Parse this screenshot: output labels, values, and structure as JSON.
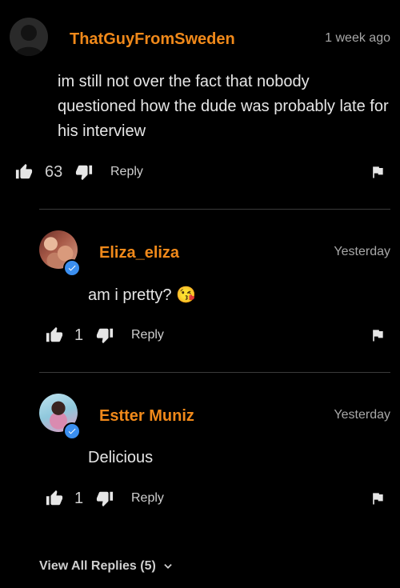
{
  "comment": {
    "username": "ThatGuyFromSweden",
    "timestamp": "1 week ago",
    "text": "im still not over the fact that nobody questioned how the dude was probably late for his interview",
    "likes": "63",
    "reply_label": "Reply"
  },
  "replies": [
    {
      "username": "Eliza_eliza",
      "timestamp": "Yesterday",
      "text": "am i pretty? 😘",
      "likes": "1",
      "reply_label": "Reply",
      "verified": true
    },
    {
      "username": "Estter Muniz",
      "timestamp": "Yesterday",
      "text": "Delicious",
      "likes": "1",
      "reply_label": "Reply",
      "verified": true
    }
  ],
  "view_all_replies": "View All Replies (5)",
  "colors": {
    "background": "#000000",
    "username": "#f0891a",
    "verified_badge": "#3b8ff0",
    "muted_text": "#a8a8a8",
    "divider": "#3a3a3a"
  },
  "icons": {
    "avatar_placeholder": "person-silhouette-icon",
    "like": "thumbs-up-icon",
    "dislike": "thumbs-down-icon",
    "report": "flag-icon",
    "verified": "check-icon",
    "expand": "chevron-down-icon"
  }
}
